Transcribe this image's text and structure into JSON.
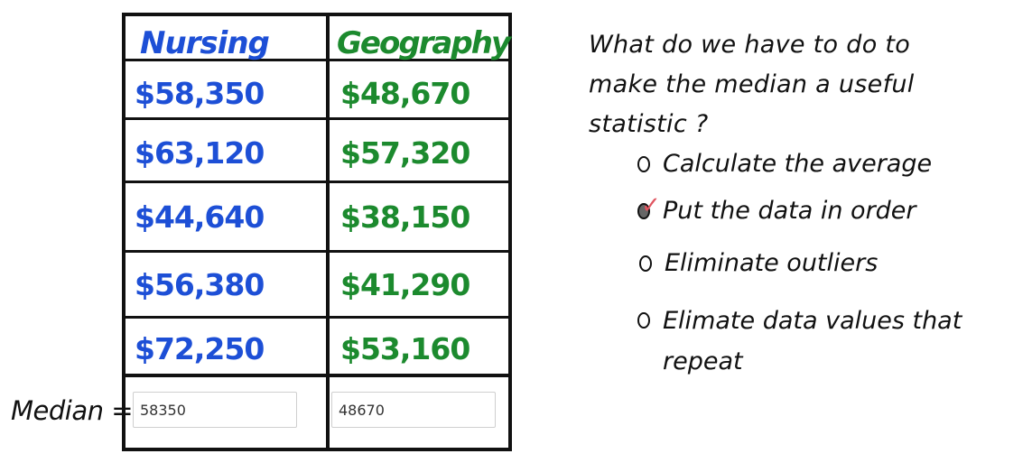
{
  "table": {
    "headers": {
      "left": "Nursing",
      "right": "Geography"
    },
    "nursing": [
      "$58,350",
      "$63,120",
      "$44,640",
      "$56,380",
      "$72,250"
    ],
    "geography": [
      "$48,670",
      "$57,320",
      "$38,150",
      "$41,290",
      "$53,160"
    ]
  },
  "median": {
    "label": "Median =",
    "nursing_value": "58350",
    "geography_value": "48670"
  },
  "question": {
    "text": "What do we have to do to make the median a useful statistic ?"
  },
  "options": [
    {
      "label": "Calculate the average",
      "checked": false
    },
    {
      "label": "Put the data in order",
      "checked": true
    },
    {
      "label": "Eliminate outliers",
      "checked": false
    },
    {
      "label": "Elimate data values that repeat",
      "checked": false
    }
  ],
  "colors": {
    "nursing": "#1d4fd6",
    "geography": "#1c8a2e",
    "check": "#e05560"
  },
  "icons": {
    "check": "✓"
  }
}
